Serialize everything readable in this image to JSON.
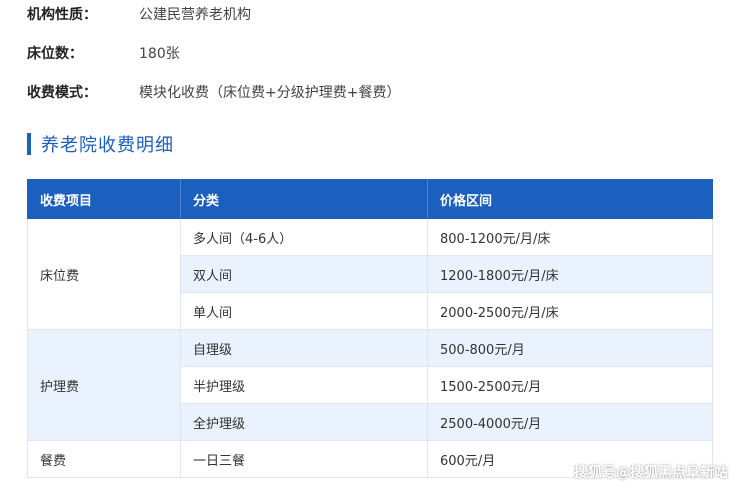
{
  "info": [
    {
      "label": "机构性质：",
      "value": "公建民营养老机构"
    },
    {
      "label": "床位数：",
      "value": "180张"
    },
    {
      "label": "收费模式：",
      "value": "模块化收费（床位费+分级护理费+餐费）"
    }
  ],
  "section_title": "养老院收费明细",
  "table": {
    "headers": [
      "收费项目",
      "分类",
      "价格区间"
    ],
    "groups": [
      {
        "item": "床位费",
        "rows": [
          {
            "category": "多人间（4-6人）",
            "price": "800-1200元/月/床"
          },
          {
            "category": "双人间",
            "price": "1200-1800元/月/床"
          },
          {
            "category": "单人间",
            "price": "2000-2500元/月/床"
          }
        ]
      },
      {
        "item": "护理费",
        "rows": [
          {
            "category": "自理级",
            "price": "500-800元/月"
          },
          {
            "category": "半护理级",
            "price": "1500-2500元/月"
          },
          {
            "category": "全护理级",
            "price": "2500-4000元/月"
          }
        ]
      },
      {
        "item": "餐费",
        "rows": [
          {
            "category": "一日三餐",
            "price": "600元/月"
          }
        ]
      }
    ]
  },
  "watermark": "搜狐号@搜狐黑点阜新站",
  "colors": {
    "accent": "#1b5fbf",
    "row_alt": "#e9f2fd",
    "border": "#dfe6f0"
  }
}
